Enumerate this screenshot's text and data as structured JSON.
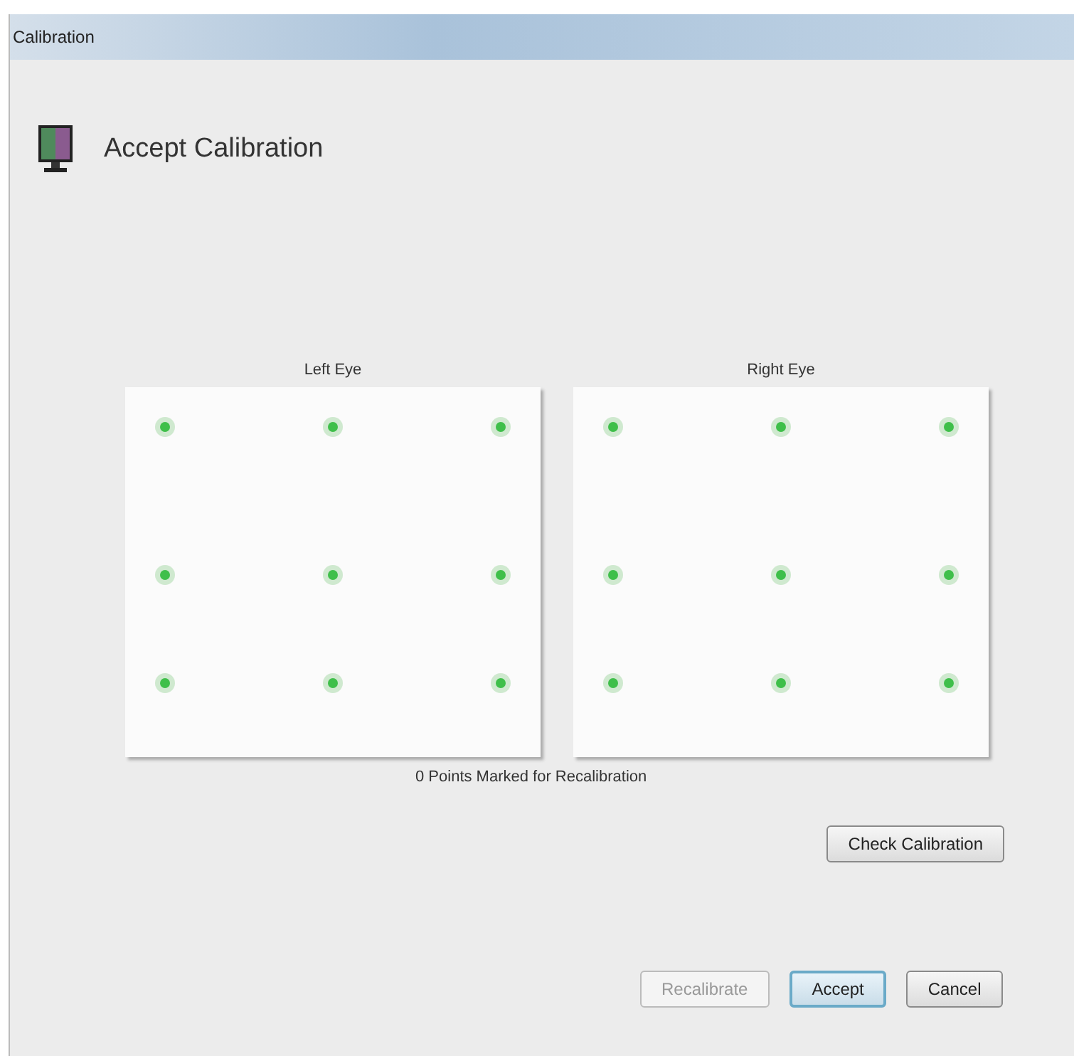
{
  "window": {
    "title": "Calibration"
  },
  "header": {
    "title": "Accept Calibration"
  },
  "eyes": [
    {
      "label": "Left Eye"
    },
    {
      "label": "Right Eye"
    }
  ],
  "status": "0 Points Marked for Recalibration",
  "check_button": {
    "label": "Check Calibration"
  },
  "buttons": [
    {
      "label": "Recalibrate",
      "disabled": true,
      "default": false
    },
    {
      "label": "Accept",
      "disabled": false,
      "default": true
    },
    {
      "label": "Cancel",
      "disabled": false,
      "default": false
    }
  ]
}
